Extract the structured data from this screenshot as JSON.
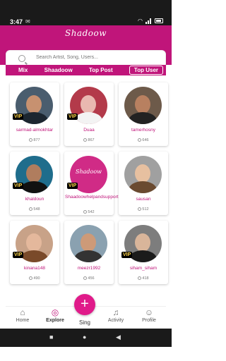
{
  "status": {
    "time": "3:47"
  },
  "header": {
    "logo": "Shadoow"
  },
  "search": {
    "placeholder": "Search Artist, Song, Users..."
  },
  "tabs": [
    "Mix",
    "Shaadoow",
    "Top Post",
    "Top User"
  ],
  "active_tab": "Top User",
  "users": [
    {
      "name": "sarmad-almokhtar",
      "followers": "877",
      "vip": true
    },
    {
      "name": "Duaa",
      "followers": "867",
      "vip": true
    },
    {
      "name": "tamerhosny",
      "followers": "646",
      "vip": false
    },
    {
      "name": "khaldoun",
      "followers": "548",
      "vip": true
    },
    {
      "name": "Shaadoowhelpandsupport",
      "followers": "542",
      "vip": true,
      "brand": "Shadoow"
    },
    {
      "name": "sausan",
      "followers": "512",
      "vip": false
    },
    {
      "name": "kinana148",
      "followers": "490",
      "vip": true
    },
    {
      "name": "meezr1992",
      "followers": "456",
      "vip": false
    },
    {
      "name": "siham_siham",
      "followers": "418",
      "vip": true
    }
  ],
  "vip_label": "VIP",
  "nav": {
    "home": "Home",
    "explore": "Explore",
    "sing": "Sing",
    "activity": "Activity",
    "profile": "Profile"
  },
  "colors": {
    "brand": "#c0157a",
    "accent": "#e01b8a"
  }
}
